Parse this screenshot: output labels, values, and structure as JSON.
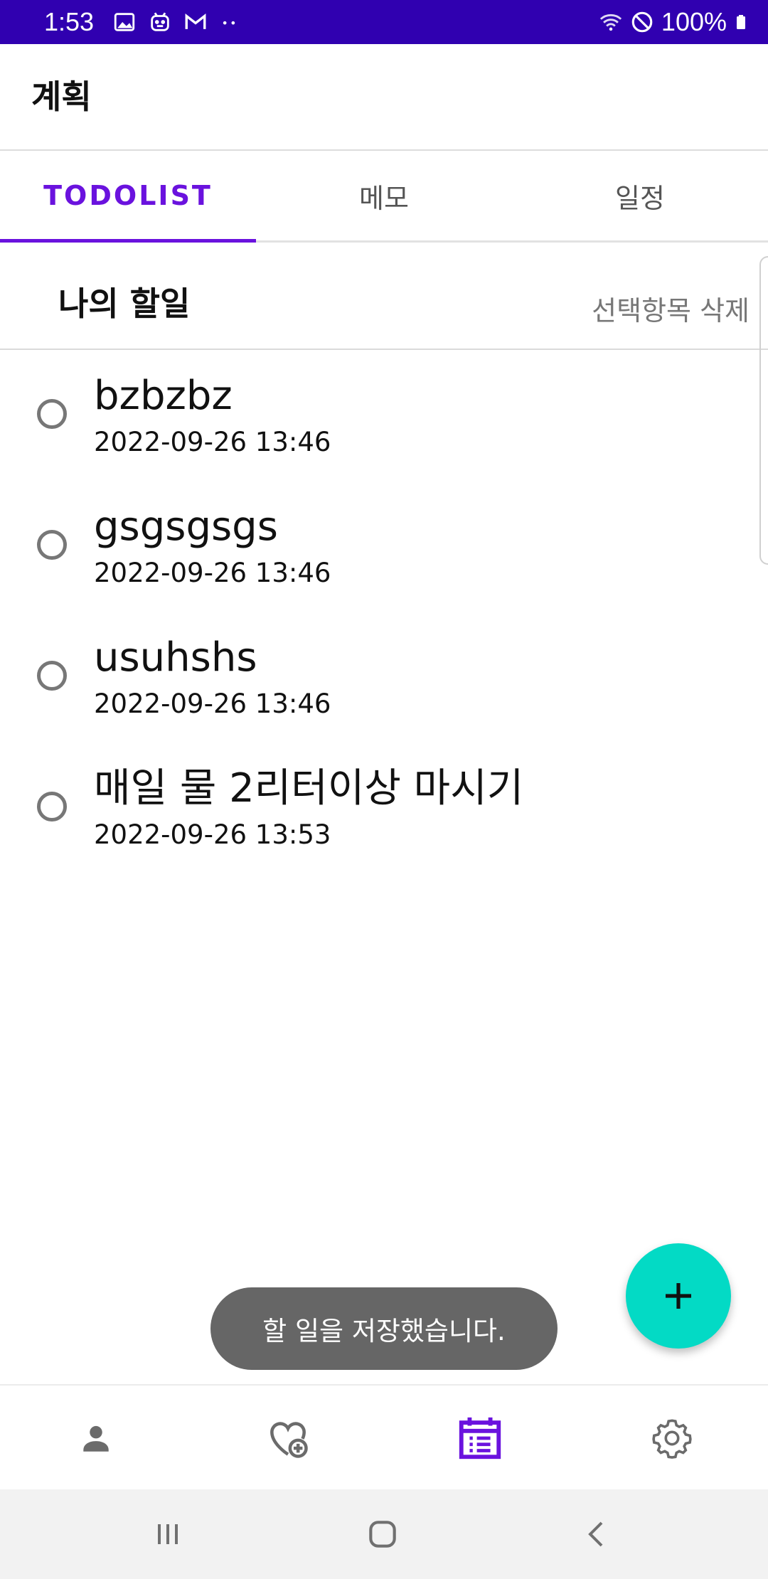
{
  "status_bar": {
    "time": "1:53",
    "battery": "100%",
    "left_icons": [
      "gallery-icon",
      "android-icon",
      "gmail-icon",
      "more-dots-icon"
    ],
    "right_icons": [
      "wifi-icon",
      "do-not-disturb-icon",
      "battery-icon"
    ]
  },
  "app_bar": {
    "title": "계획"
  },
  "tabs": [
    {
      "label": "TODOLIST",
      "active": true
    },
    {
      "label": "메모",
      "active": false
    },
    {
      "label": "일정",
      "active": false
    }
  ],
  "section": {
    "title": "나의 할일",
    "delete_label": "선택항목 삭제"
  },
  "todos": [
    {
      "title": "bzbzbz",
      "date": "2022-09-26 13:46",
      "checked": false
    },
    {
      "title": "gsgsgsgs",
      "date": "2022-09-26 13:46",
      "checked": false
    },
    {
      "title": "usuhshs",
      "date": "2022-09-26 13:46",
      "checked": false
    },
    {
      "title": "매일 물 2리터이상 마시기",
      "date": "2022-09-26 13:53",
      "checked": false
    }
  ],
  "fab": {
    "icon": "plus-icon"
  },
  "toast": {
    "text": "할 일을 저장했습니다."
  },
  "bottom_nav": [
    {
      "icon": "person-icon",
      "active": false
    },
    {
      "icon": "heart-plus-icon",
      "active": false
    },
    {
      "icon": "calendar-list-icon",
      "active": true
    },
    {
      "icon": "gear-icon",
      "active": false
    }
  ],
  "colors": {
    "status_bar": "#3000b0",
    "accent": "#6a12de",
    "fab": "#03dac5",
    "toast": "#666666",
    "inactive_icon": "#6b6b6b"
  }
}
